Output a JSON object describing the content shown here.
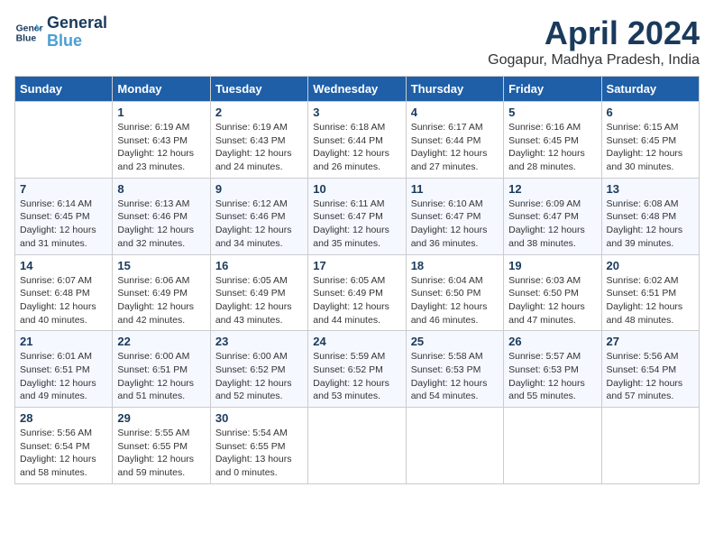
{
  "header": {
    "logo_line1": "General",
    "logo_line2": "Blue",
    "month_title": "April 2024",
    "location": "Gogapur, Madhya Pradesh, India"
  },
  "columns": [
    "Sunday",
    "Monday",
    "Tuesday",
    "Wednesday",
    "Thursday",
    "Friday",
    "Saturday"
  ],
  "weeks": [
    [
      {
        "day": "",
        "text": ""
      },
      {
        "day": "1",
        "text": "Sunrise: 6:19 AM\nSunset: 6:43 PM\nDaylight: 12 hours\nand 23 minutes."
      },
      {
        "day": "2",
        "text": "Sunrise: 6:19 AM\nSunset: 6:43 PM\nDaylight: 12 hours\nand 24 minutes."
      },
      {
        "day": "3",
        "text": "Sunrise: 6:18 AM\nSunset: 6:44 PM\nDaylight: 12 hours\nand 26 minutes."
      },
      {
        "day": "4",
        "text": "Sunrise: 6:17 AM\nSunset: 6:44 PM\nDaylight: 12 hours\nand 27 minutes."
      },
      {
        "day": "5",
        "text": "Sunrise: 6:16 AM\nSunset: 6:45 PM\nDaylight: 12 hours\nand 28 minutes."
      },
      {
        "day": "6",
        "text": "Sunrise: 6:15 AM\nSunset: 6:45 PM\nDaylight: 12 hours\nand 30 minutes."
      }
    ],
    [
      {
        "day": "7",
        "text": "Sunrise: 6:14 AM\nSunset: 6:45 PM\nDaylight: 12 hours\nand 31 minutes."
      },
      {
        "day": "8",
        "text": "Sunrise: 6:13 AM\nSunset: 6:46 PM\nDaylight: 12 hours\nand 32 minutes."
      },
      {
        "day": "9",
        "text": "Sunrise: 6:12 AM\nSunset: 6:46 PM\nDaylight: 12 hours\nand 34 minutes."
      },
      {
        "day": "10",
        "text": "Sunrise: 6:11 AM\nSunset: 6:47 PM\nDaylight: 12 hours\nand 35 minutes."
      },
      {
        "day": "11",
        "text": "Sunrise: 6:10 AM\nSunset: 6:47 PM\nDaylight: 12 hours\nand 36 minutes."
      },
      {
        "day": "12",
        "text": "Sunrise: 6:09 AM\nSunset: 6:47 PM\nDaylight: 12 hours\nand 38 minutes."
      },
      {
        "day": "13",
        "text": "Sunrise: 6:08 AM\nSunset: 6:48 PM\nDaylight: 12 hours\nand 39 minutes."
      }
    ],
    [
      {
        "day": "14",
        "text": "Sunrise: 6:07 AM\nSunset: 6:48 PM\nDaylight: 12 hours\nand 40 minutes."
      },
      {
        "day": "15",
        "text": "Sunrise: 6:06 AM\nSunset: 6:49 PM\nDaylight: 12 hours\nand 42 minutes."
      },
      {
        "day": "16",
        "text": "Sunrise: 6:05 AM\nSunset: 6:49 PM\nDaylight: 12 hours\nand 43 minutes."
      },
      {
        "day": "17",
        "text": "Sunrise: 6:05 AM\nSunset: 6:49 PM\nDaylight: 12 hours\nand 44 minutes."
      },
      {
        "day": "18",
        "text": "Sunrise: 6:04 AM\nSunset: 6:50 PM\nDaylight: 12 hours\nand 46 minutes."
      },
      {
        "day": "19",
        "text": "Sunrise: 6:03 AM\nSunset: 6:50 PM\nDaylight: 12 hours\nand 47 minutes."
      },
      {
        "day": "20",
        "text": "Sunrise: 6:02 AM\nSunset: 6:51 PM\nDaylight: 12 hours\nand 48 minutes."
      }
    ],
    [
      {
        "day": "21",
        "text": "Sunrise: 6:01 AM\nSunset: 6:51 PM\nDaylight: 12 hours\nand 49 minutes."
      },
      {
        "day": "22",
        "text": "Sunrise: 6:00 AM\nSunset: 6:51 PM\nDaylight: 12 hours\nand 51 minutes."
      },
      {
        "day": "23",
        "text": "Sunrise: 6:00 AM\nSunset: 6:52 PM\nDaylight: 12 hours\nand 52 minutes."
      },
      {
        "day": "24",
        "text": "Sunrise: 5:59 AM\nSunset: 6:52 PM\nDaylight: 12 hours\nand 53 minutes."
      },
      {
        "day": "25",
        "text": "Sunrise: 5:58 AM\nSunset: 6:53 PM\nDaylight: 12 hours\nand 54 minutes."
      },
      {
        "day": "26",
        "text": "Sunrise: 5:57 AM\nSunset: 6:53 PM\nDaylight: 12 hours\nand 55 minutes."
      },
      {
        "day": "27",
        "text": "Sunrise: 5:56 AM\nSunset: 6:54 PM\nDaylight: 12 hours\nand 57 minutes."
      }
    ],
    [
      {
        "day": "28",
        "text": "Sunrise: 5:56 AM\nSunset: 6:54 PM\nDaylight: 12 hours\nand 58 minutes."
      },
      {
        "day": "29",
        "text": "Sunrise: 5:55 AM\nSunset: 6:55 PM\nDaylight: 12 hours\nand 59 minutes."
      },
      {
        "day": "30",
        "text": "Sunrise: 5:54 AM\nSunset: 6:55 PM\nDaylight: 13 hours\nand 0 minutes."
      },
      {
        "day": "",
        "text": ""
      },
      {
        "day": "",
        "text": ""
      },
      {
        "day": "",
        "text": ""
      },
      {
        "day": "",
        "text": ""
      }
    ]
  ]
}
